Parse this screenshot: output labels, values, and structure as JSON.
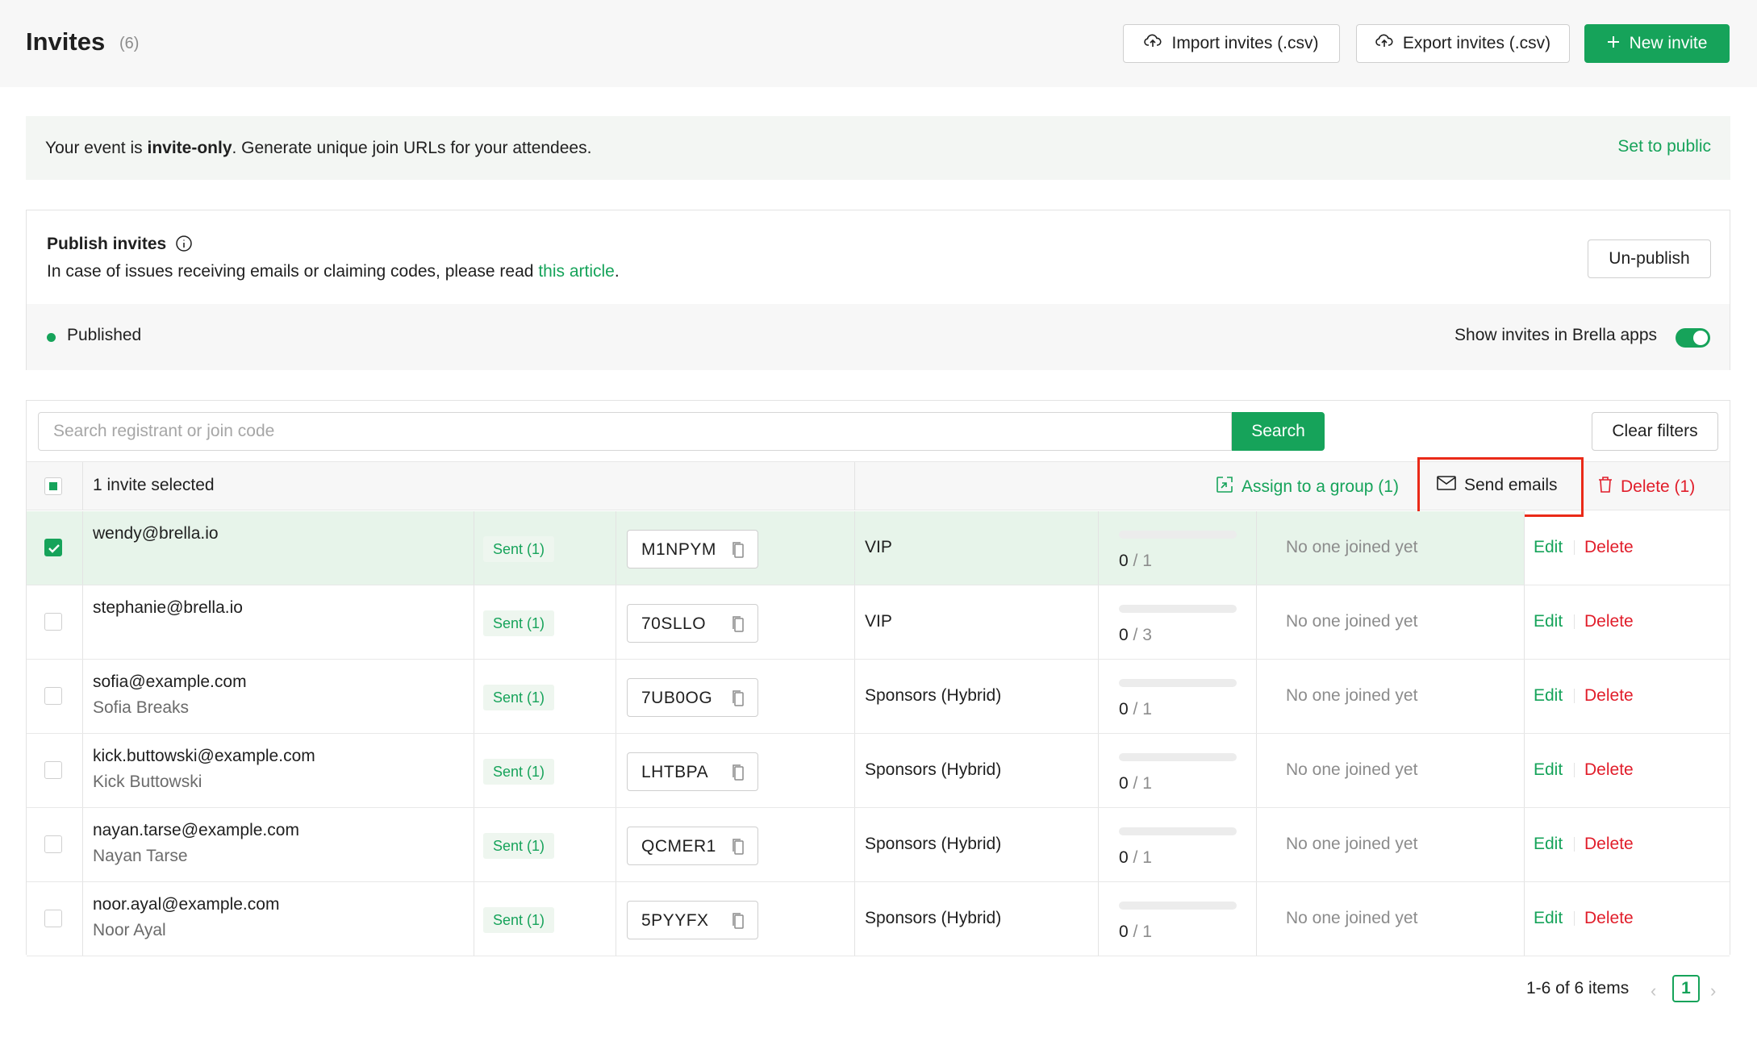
{
  "header": {
    "title": "Invites",
    "count": "(6)",
    "import_label": "Import invites (.csv)",
    "export_label": "Export invites (.csv)",
    "new_label": "New invite"
  },
  "banner": {
    "text_prefix": "Your event is ",
    "text_bold": "invite-only",
    "text_suffix": ". Generate unique join URLs for your attendees.",
    "link": "Set to public"
  },
  "publish": {
    "title": "Publish invites",
    "desc_prefix": "In case of issues receiving emails or claiming codes, please read ",
    "desc_link": "this article",
    "desc_suffix": ".",
    "unpublish_label": "Un-publish",
    "status": "Published",
    "show_label": "Show invites in Brella apps",
    "show_enabled": true
  },
  "search": {
    "placeholder": "Search registrant or join code",
    "button": "Search",
    "clear": "Clear filters"
  },
  "selection": {
    "count_label": "1 invite selected",
    "assign_label": "Assign to a group (1)",
    "send_label": "Send emails",
    "delete_label": "Delete (1)"
  },
  "rows": [
    {
      "email": "wendy@brella.io",
      "name": "",
      "status": "Sent (1)",
      "code": "M1NPYM",
      "group": "VIP",
      "used": "0",
      "total": "1",
      "joined": "No one joined yet",
      "edit": "Edit",
      "delete": "Delete",
      "selected": true
    },
    {
      "email": "stephanie@brella.io",
      "name": "",
      "status": "Sent (1)",
      "code": "70SLLO",
      "group": "VIP",
      "used": "0",
      "total": "3",
      "joined": "No one joined yet",
      "edit": "Edit",
      "delete": "Delete",
      "selected": false
    },
    {
      "email": "sofia@example.com",
      "name": "Sofia Breaks",
      "status": "Sent (1)",
      "code": "7UB0OG",
      "group": "Sponsors (Hybrid)",
      "used": "0",
      "total": "1",
      "joined": "No one joined yet",
      "edit": "Edit",
      "delete": "Delete",
      "selected": false
    },
    {
      "email": "kick.buttowski@example.com",
      "name": "Kick Buttowski",
      "status": "Sent (1)",
      "code": "LHTBPA",
      "group": "Sponsors (Hybrid)",
      "used": "0",
      "total": "1",
      "joined": "No one joined yet",
      "edit": "Edit",
      "delete": "Delete",
      "selected": false
    },
    {
      "email": "nayan.tarse@example.com",
      "name": "Nayan Tarse",
      "status": "Sent (1)",
      "code": "QCMER1",
      "group": "Sponsors (Hybrid)",
      "used": "0",
      "total": "1",
      "joined": "No one joined yet",
      "edit": "Edit",
      "delete": "Delete",
      "selected": false
    },
    {
      "email": "noor.ayal@example.com",
      "name": "Noor Ayal",
      "status": "Sent (1)",
      "code": "5PYYFX",
      "group": "Sponsors (Hybrid)",
      "used": "0",
      "total": "1",
      "joined": "No one joined yet",
      "edit": "Edit",
      "delete": "Delete",
      "selected": false
    }
  ],
  "pagination": {
    "summary": "1-6 of 6 items",
    "current": "1",
    "prev_icon": "chevron-left-icon",
    "next_icon": "chevron-right-icon"
  },
  "colors": {
    "accent": "#16a35a",
    "danger": "#e11d2a",
    "highlight_box": "#ea2a18",
    "selected_row": "#e7f4ea"
  }
}
